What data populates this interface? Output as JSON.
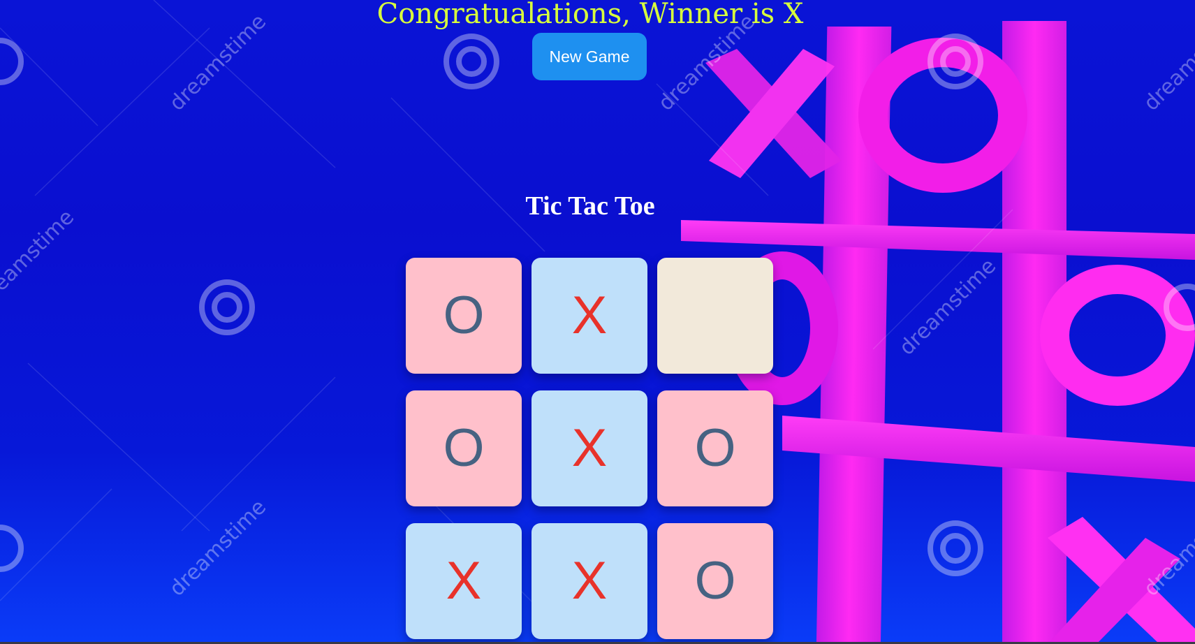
{
  "status": {
    "message": "Congratualations, Winner is X"
  },
  "controls": {
    "new_game_label": "New Game"
  },
  "game": {
    "title": "Tic Tac Toe",
    "board": [
      [
        "O",
        "X",
        ""
      ],
      [
        "O",
        "X",
        "O"
      ],
      [
        "X",
        "X",
        "O"
      ]
    ],
    "winner": "X"
  },
  "background": {
    "watermark_text": "dreamstime"
  },
  "colors": {
    "message": "#d8ff3c",
    "new_game_button": "#1e90f0",
    "cell_o_bg": "#ffc0cb",
    "cell_x_bg": "#bfe0fa",
    "cell_empty_bg": "#f2e9da",
    "mark_o": "#466282",
    "mark_x": "#e8322a",
    "background_blue": "#0a14d6",
    "background_art": "#ff20f0"
  }
}
